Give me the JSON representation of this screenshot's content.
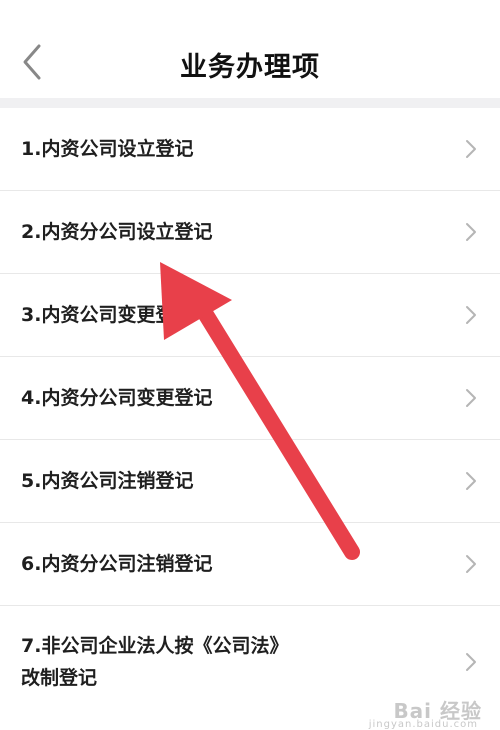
{
  "header": {
    "title": "业务办理项",
    "back_icon": "chevron-left-icon"
  },
  "items": [
    {
      "label": "1.内资公司设立登记"
    },
    {
      "label": "2.内资分公司设立登记"
    },
    {
      "label": "3.内资公司变更登记"
    },
    {
      "label": "4.内资分公司变更登记"
    },
    {
      "label": "5.内资公司注销登记"
    },
    {
      "label": "6.内资分公司注销登记"
    },
    {
      "label": "7.非公司企业法人按《公司法》\n改制登记"
    }
  ],
  "annotation": {
    "arrow_color": "#e8404a",
    "icon": "red-arrow-icon"
  },
  "watermark": {
    "brand": "Bai 经验",
    "domain": "jingyan.baidu.com"
  },
  "colors": {
    "background": "#ffffff",
    "separator": "#f0f0f2",
    "chevron": "#b5b5b5"
  }
}
